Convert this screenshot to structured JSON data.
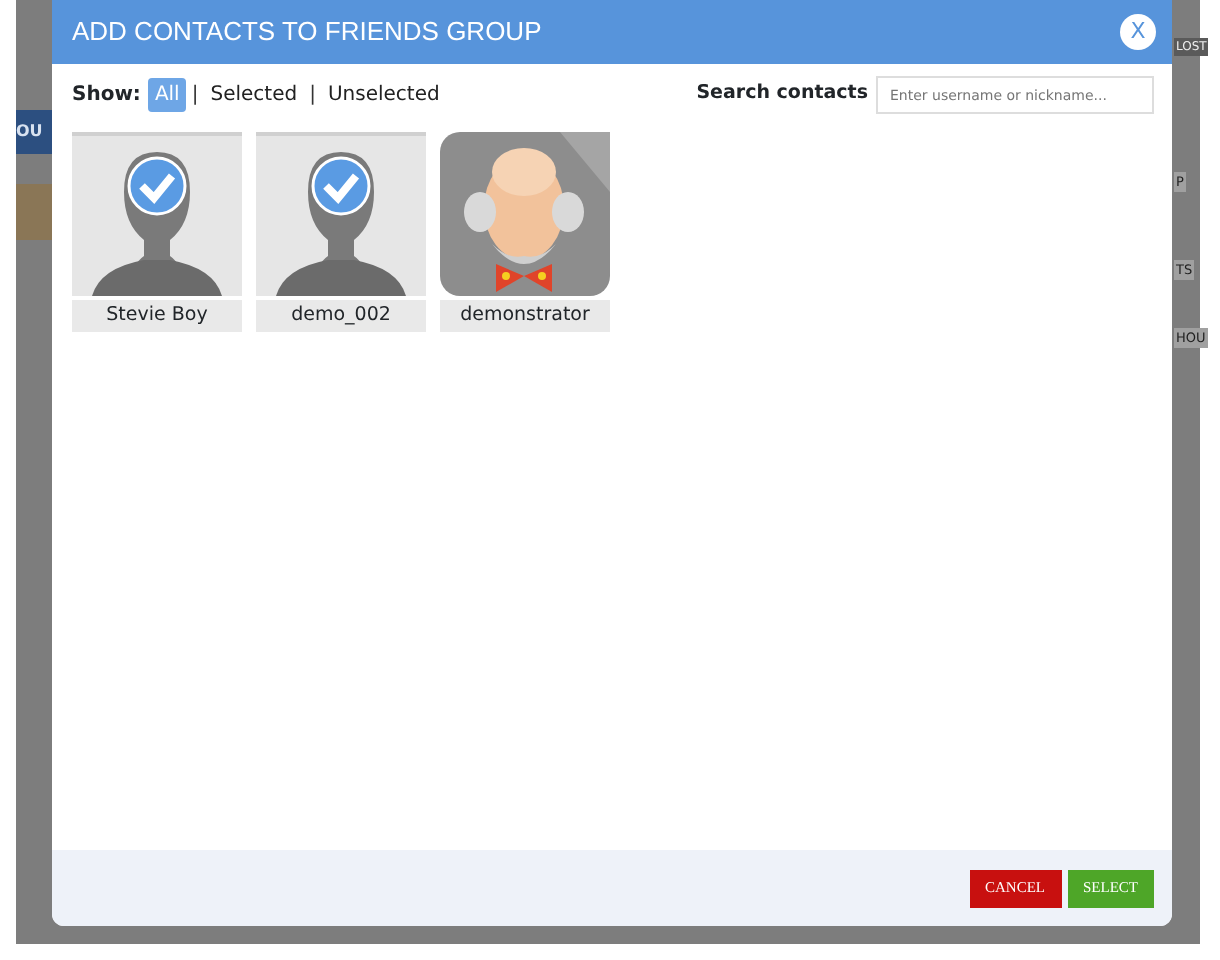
{
  "background_page": {
    "fragments": [
      {
        "text": "OU"
      },
      {
        "text": "LOST"
      },
      {
        "text": "P"
      },
      {
        "text": "TS"
      },
      {
        "text": "HOU"
      }
    ]
  },
  "dialog": {
    "title": "ADD CONTACTS TO FRIENDS GROUP",
    "close": "X"
  },
  "filter": {
    "label": "Show:",
    "separators": [
      "|",
      "|"
    ],
    "options": [
      {
        "label": "All",
        "selected": true
      },
      {
        "label": "Selected",
        "selected": false
      },
      {
        "label": "Unselected",
        "selected": false
      }
    ]
  },
  "search": {
    "label": "Search contacts",
    "placeholder": "Enter username or nickname..."
  },
  "contacts": [
    {
      "name": "Stevie Boy",
      "kind": "silhouette",
      "selected": true
    },
    {
      "name": "demo_002",
      "kind": "silhouette",
      "selected": true
    },
    {
      "name": "demonstrator",
      "kind": "cartoon",
      "selected": false
    }
  ],
  "buttons": [
    {
      "label": "CANCEL",
      "kind": "cancel"
    },
    {
      "label": "SELECT",
      "kind": "primary"
    }
  ]
}
